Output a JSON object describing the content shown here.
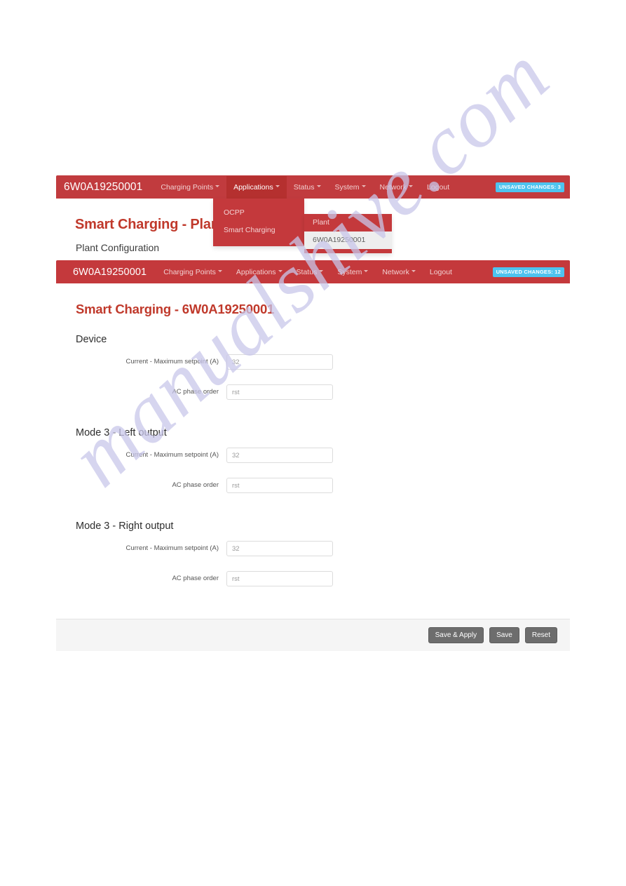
{
  "screen_one": {
    "brand": "6W0A19250001",
    "nav_items": [
      {
        "label": "Charging Points",
        "caret": true
      },
      {
        "label": "Applications",
        "caret": true
      },
      {
        "label": "Status",
        "caret": true
      },
      {
        "label": "System",
        "caret": true
      },
      {
        "label": "Network",
        "caret": true
      },
      {
        "label": "Logout",
        "caret": false
      }
    ],
    "badge": "UNSAVED CHANGES: 3",
    "applications_dropdown": [
      {
        "label": "OCPP"
      },
      {
        "label": "Smart Charging"
      }
    ],
    "smart_charging_submenu": [
      {
        "label": "Plant",
        "active": false
      },
      {
        "label": "6W0A19250001",
        "active": true
      }
    ],
    "title": "Smart Charging - Plant",
    "subtitle": "Plant Configuration"
  },
  "screen_two": {
    "brand": "6W0A19250001",
    "nav_items": [
      {
        "label": "Charging Points",
        "caret": true
      },
      {
        "label": "Applications",
        "caret": true
      },
      {
        "label": "Status",
        "caret": true
      },
      {
        "label": "System",
        "caret": true
      },
      {
        "label": "Network",
        "caret": true
      },
      {
        "label": "Logout",
        "caret": false
      }
    ],
    "badge": "UNSAVED CHANGES: 12",
    "title": "Smart Charging - 6W0A19250001",
    "sections": [
      {
        "heading": "Device",
        "fields": [
          {
            "label": "Current - Maximum setpoint (A)",
            "value": "32",
            "placeholder": "32"
          },
          {
            "label": "AC phase order",
            "value": "rst",
            "placeholder": "rst"
          }
        ]
      },
      {
        "heading": "Mode 3 - Left output",
        "fields": [
          {
            "label": "Current - Maximum setpoint (A)",
            "value": "32",
            "placeholder": "32"
          },
          {
            "label": "AC phase order",
            "value": "rst",
            "placeholder": "rst"
          }
        ]
      },
      {
        "heading": "Mode 3 - Right output",
        "fields": [
          {
            "label": "Current - Maximum setpoint (A)",
            "value": "32",
            "placeholder": "32"
          },
          {
            "label": "AC phase order",
            "value": "rst",
            "placeholder": "rst"
          }
        ]
      }
    ],
    "buttons": [
      {
        "label": "Save & Apply"
      },
      {
        "label": "Save"
      },
      {
        "label": "Reset"
      }
    ]
  },
  "watermark": {
    "text": "manualshive.com"
  },
  "colors": {
    "brand_red": "#c4393c",
    "title_red": "#c0392b",
    "badge_blue": "#4ec3ef",
    "button_gray": "#6d6d6d",
    "footer_gray": "#f5f5f5"
  }
}
